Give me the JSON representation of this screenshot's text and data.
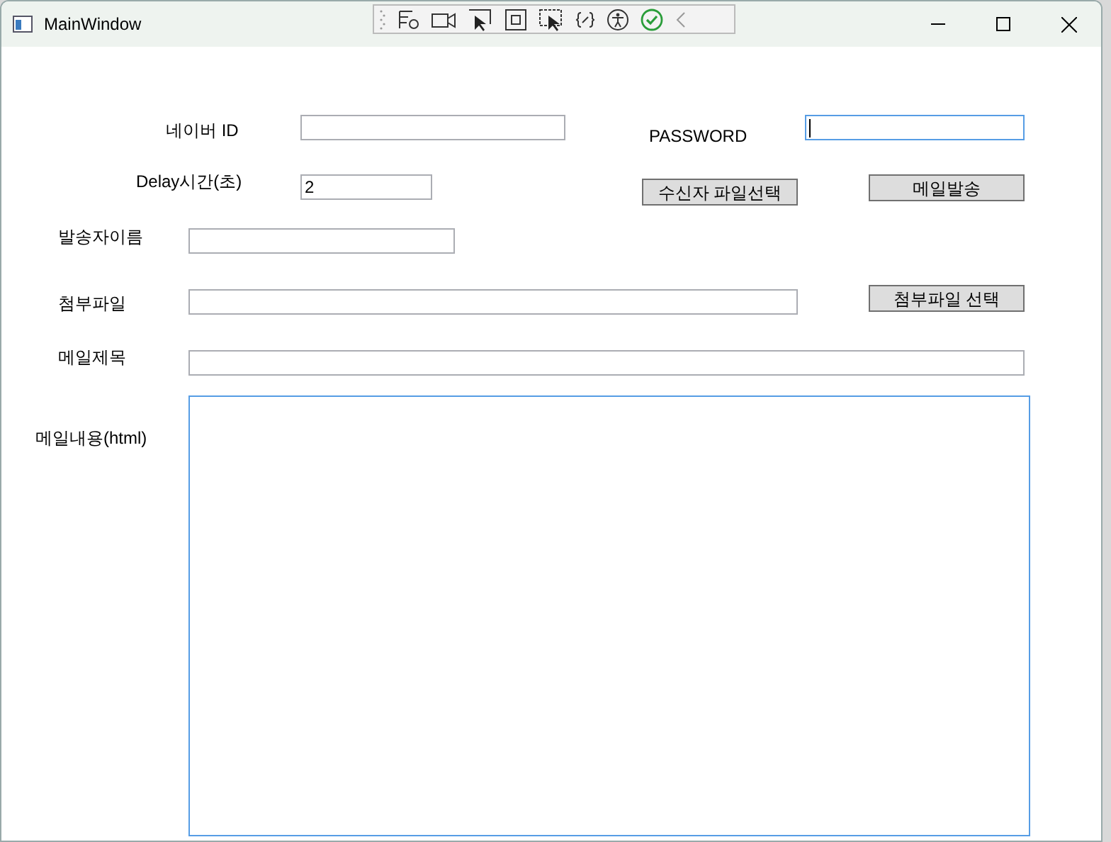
{
  "window": {
    "title": "MainWindow"
  },
  "rows": [
    {
      "items": [
        {
          "kind": "label",
          "text": "네이버 ID"
        },
        {
          "kind": "input",
          "focused": false
        },
        {
          "kind": "label",
          "text": "PASSWORD"
        },
        {
          "kind": "input",
          "focused": true
        }
      ]
    },
    {
      "items": [
        {
          "kind": "label",
          "text": "Delay시간(초)"
        },
        {
          "kind": "input",
          "value": "2",
          "focused": false
        },
        {
          "kind": "button",
          "text": "수신자 파일선택"
        },
        {
          "kind": "button",
          "text": "메일발송"
        }
      ]
    },
    {
      "items": [
        {
          "kind": "label",
          "text": "발송자이름"
        },
        {
          "kind": "input",
          "focused": false
        }
      ]
    },
    {
      "items": [
        {
          "kind": "label",
          "text": "첨부파일"
        },
        {
          "kind": "input",
          "focused": false
        },
        {
          "kind": "button",
          "text": "첨부파일 선택"
        }
      ]
    },
    {
      "items": [
        {
          "kind": "label",
          "text": "메일제목"
        },
        {
          "kind": "input",
          "focused": false
        }
      ]
    },
    {
      "items": [
        {
          "kind": "label",
          "text": "메일내용(html)"
        },
        {
          "kind": "textarea",
          "focused": true
        }
      ]
    }
  ]
}
